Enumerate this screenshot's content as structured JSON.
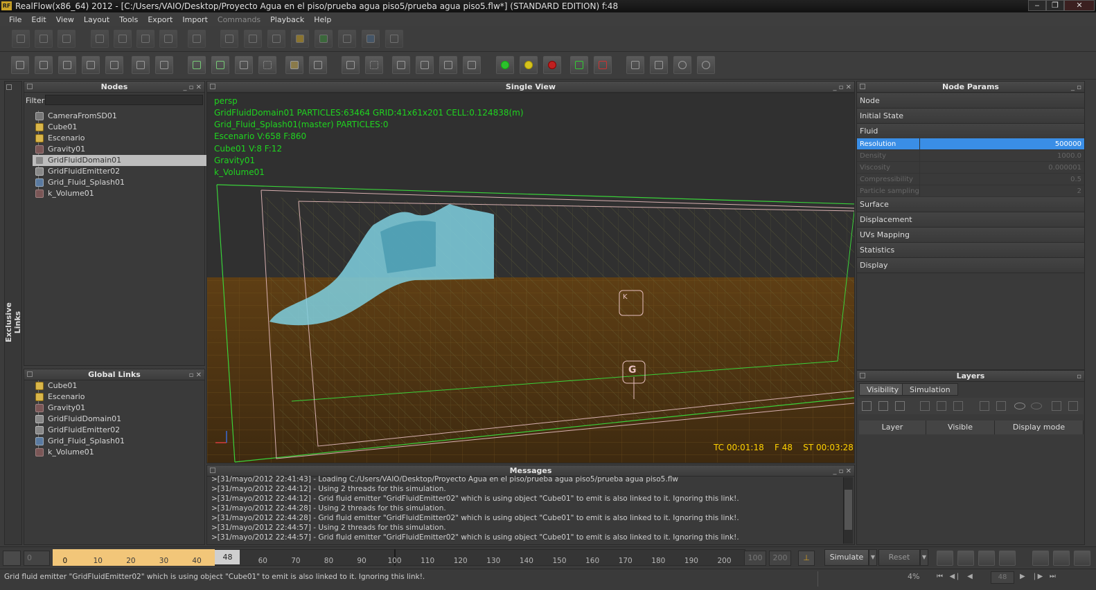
{
  "window": {
    "title": "RealFlow(x86_64) 2012 - [C:/Users/VAIO/Desktop/Proyecto Agua en el piso/prueba agua piso5/prueba agua piso5.flw*] (STANDARD EDITION) f:48",
    "logo": "RF"
  },
  "window_buttons": {
    "minimize": "‒",
    "restore": "❐",
    "close": "✕"
  },
  "menu": [
    "File",
    "Edit",
    "View",
    "Layout",
    "Tools",
    "Export",
    "Import",
    "Commands",
    "Playback",
    "Help"
  ],
  "nodes_panel": {
    "title": "Nodes",
    "filter_label": "Filter",
    "filter_value": "",
    "items": [
      {
        "label": "CameraFromSD01",
        "icon": "camera-icon"
      },
      {
        "label": "Cube01",
        "icon": "cube-icon"
      },
      {
        "label": "Escenario",
        "icon": "cube-icon"
      },
      {
        "label": "Gravity01",
        "icon": "daemon-icon"
      },
      {
        "label": "GridFluidDomain01",
        "icon": "grid-domain-icon"
      },
      {
        "label": "GridFluidEmitter02",
        "icon": "grid-emitter-icon"
      },
      {
        "label": "Grid_Fluid_Splash01",
        "icon": "splash-icon"
      },
      {
        "label": "k_Volume01",
        "icon": "daemon-icon"
      }
    ]
  },
  "exclusive_links_label": "Exclusive Links",
  "global_links": {
    "title": "Global Links",
    "items": [
      {
        "label": "Cube01",
        "icon": "cube-icon"
      },
      {
        "label": "Escenario",
        "icon": "cube-icon"
      },
      {
        "label": "Gravity01",
        "icon": "daemon-icon"
      },
      {
        "label": "GridFluidDomain01",
        "icon": "grid-domain-icon"
      },
      {
        "label": "GridFluidEmitter02",
        "icon": "grid-emitter-icon"
      },
      {
        "label": "Grid_Fluid_Splash01",
        "icon": "splash-icon"
      },
      {
        "label": "k_Volume01",
        "icon": "daemon-icon"
      }
    ]
  },
  "viewport": {
    "title": "Single View",
    "camera": "persp",
    "info": [
      "GridFluidDomain01 PARTICLES:63464 GRID:41x61x201 CELL:0.124838(m)",
      "Grid_Fluid_Splash01(master) PARTICLES:0",
      "Escenario V:658 F:860",
      "Cube01 V:8 F:12",
      "Gravity01",
      "k_Volume01"
    ],
    "tc": "TC 00:01:18",
    "frame": "F 48",
    "st": "ST 00:03:28",
    "gizmo_k": "K",
    "gizmo_g": "G"
  },
  "node_params": {
    "title": "Node Params",
    "sections": [
      "Node",
      "Initial State",
      "Fluid"
    ],
    "fluid_params": [
      {
        "label": "Resolution",
        "value": "500000",
        "selected": true
      },
      {
        "label": "Density",
        "value": "1000.0"
      },
      {
        "label": "Viscosity",
        "value": "0.000001"
      },
      {
        "label": "Compressibility",
        "value": "0.5"
      },
      {
        "label": "Particle sampling",
        "value": "2"
      }
    ],
    "more_sections": [
      "Surface",
      "Displacement",
      "UVs Mapping",
      "Statistics",
      "Display"
    ]
  },
  "layers": {
    "title": "Layers",
    "tabs": [
      "Visibility",
      "Simulation"
    ],
    "columns": [
      "Layer",
      "Visible",
      "Display mode"
    ]
  },
  "messages": {
    "title": "Messages",
    "lines": [
      ">[31/mayo/2012 22:41:43] - Loading C:/Users/VAIO/Desktop/Proyecto Agua en el piso/prueba agua piso5/prueba agua piso5.flw",
      ">[31/mayo/2012 22:44:12] - Using 2 threads for this simulation.",
      ">[31/mayo/2012 22:44:12] - Grid fluid emitter \"GridFluidEmitter02\" which is using object \"Cube01\" to emit is also linked to it. Ignoring this link!.",
      ">[31/mayo/2012 22:44:28] - Using 2 threads for this simulation.",
      ">[31/mayo/2012 22:44:28] - Grid fluid emitter \"GridFluidEmitter02\" which is using object \"Cube01\" to emit is also linked to it. Ignoring this link!.",
      ">[31/mayo/2012 22:44:57] - Using 2 threads for this simulation.",
      ">[31/mayo/2012 22:44:57] - Grid fluid emitter \"GridFluidEmitter02\" which is using object \"Cube01\" to emit is also linked to it. Ignoring this link!."
    ]
  },
  "timeline": {
    "start": "0",
    "current": "48",
    "ticks": [
      "0",
      "10",
      "20",
      "30",
      "40",
      "60",
      "70",
      "80",
      "90",
      "100",
      "110",
      "120",
      "130",
      "140",
      "150",
      "160",
      "170",
      "180",
      "190",
      "200"
    ],
    "end_a": "100",
    "end_b": "200",
    "cached_until_frame": 48
  },
  "playback": {
    "simulate": "Simulate",
    "reset": "Reset",
    "percent": "4%",
    "frame_field": "48"
  },
  "status": "Grid fluid emitter \"GridFluidEmitter02\" which is using object \"Cube01\" to emit is also linked to it. Ignoring this link!.",
  "colors": {
    "accent": "#3a8ee6",
    "viewport_text": "#1fd41f",
    "overlay_text": "#ffd200",
    "timeline_cache": "#f2c679"
  }
}
